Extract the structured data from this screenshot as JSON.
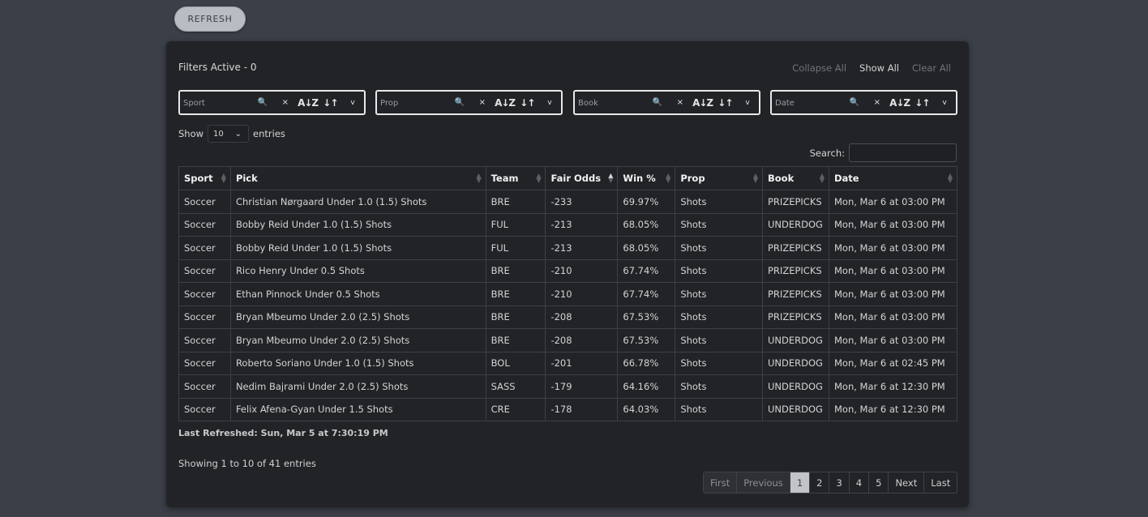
{
  "refresh_label": "REFRESH",
  "filters_active": "Filters Active - 0",
  "top_links": {
    "collapse_all": "Collapse All",
    "show_all": "Show All",
    "clear_all": "Clear All"
  },
  "filters": [
    {
      "label": "Sport"
    },
    {
      "label": "Prop"
    },
    {
      "label": "Book"
    },
    {
      "label": "Date"
    }
  ],
  "filter_icons": {
    "search": "🔍",
    "clear": "×",
    "sort_alpha": "A↓Z",
    "sort": "↓↑",
    "expand": "v"
  },
  "length": {
    "show": "Show",
    "value": "10",
    "entries": "entries"
  },
  "search": {
    "label": "Search:"
  },
  "table": {
    "headers": [
      "Sport",
      "Pick",
      "Team",
      "Fair Odds",
      "Win %",
      "Prop",
      "Book",
      "Date"
    ],
    "rows": [
      [
        "Soccer",
        "Christian Nørgaard Under 1.0 (1.5) Shots",
        "BRE",
        "-233",
        "69.97%",
        "Shots",
        "PRIZEPICKS",
        "Mon, Mar 6 at 03:00 PM"
      ],
      [
        "Soccer",
        "Bobby Reid Under 1.0 (1.5) Shots",
        "FUL",
        "-213",
        "68.05%",
        "Shots",
        "UNDERDOG",
        "Mon, Mar 6 at 03:00 PM"
      ],
      [
        "Soccer",
        "Bobby Reid Under 1.0 (1.5) Shots",
        "FUL",
        "-213",
        "68.05%",
        "Shots",
        "PRIZEPICKS",
        "Mon, Mar 6 at 03:00 PM"
      ],
      [
        "Soccer",
        "Rico Henry Under 0.5 Shots",
        "BRE",
        "-210",
        "67.74%",
        "Shots",
        "PRIZEPICKS",
        "Mon, Mar 6 at 03:00 PM"
      ],
      [
        "Soccer",
        "Ethan Pinnock Under 0.5 Shots",
        "BRE",
        "-210",
        "67.74%",
        "Shots",
        "PRIZEPICKS",
        "Mon, Mar 6 at 03:00 PM"
      ],
      [
        "Soccer",
        "Bryan Mbeumo Under 2.0 (2.5) Shots",
        "BRE",
        "-208",
        "67.53%",
        "Shots",
        "PRIZEPICKS",
        "Mon, Mar 6 at 03:00 PM"
      ],
      [
        "Soccer",
        "Bryan Mbeumo Under 2.0 (2.5) Shots",
        "BRE",
        "-208",
        "67.53%",
        "Shots",
        "UNDERDOG",
        "Mon, Mar 6 at 03:00 PM"
      ],
      [
        "Soccer",
        "Roberto Soriano Under 1.0 (1.5) Shots",
        "BOL",
        "-201",
        "66.78%",
        "Shots",
        "UNDERDOG",
        "Mon, Mar 6 at 02:45 PM"
      ],
      [
        "Soccer",
        "Nedim Bajrami Under 2.0 (2.5) Shots",
        "SASS",
        "-179",
        "64.16%",
        "Shots",
        "UNDERDOG",
        "Mon, Mar 6 at 12:30 PM"
      ],
      [
        "Soccer",
        "Felix Afena-Gyan Under 1.5 Shots",
        "CRE",
        "-178",
        "64.03%",
        "Shots",
        "UNDERDOG",
        "Mon, Mar 6 at 12:30 PM"
      ]
    ]
  },
  "last_refreshed": "Last Refreshed: Sun, Mar 5 at 7:30:19 PM",
  "showing": "Showing 1 to 10 of 41 entries",
  "pager": [
    "First",
    "Previous",
    "1",
    "2",
    "3",
    "4",
    "5",
    "Next",
    "Last"
  ],
  "pager_current": "1"
}
